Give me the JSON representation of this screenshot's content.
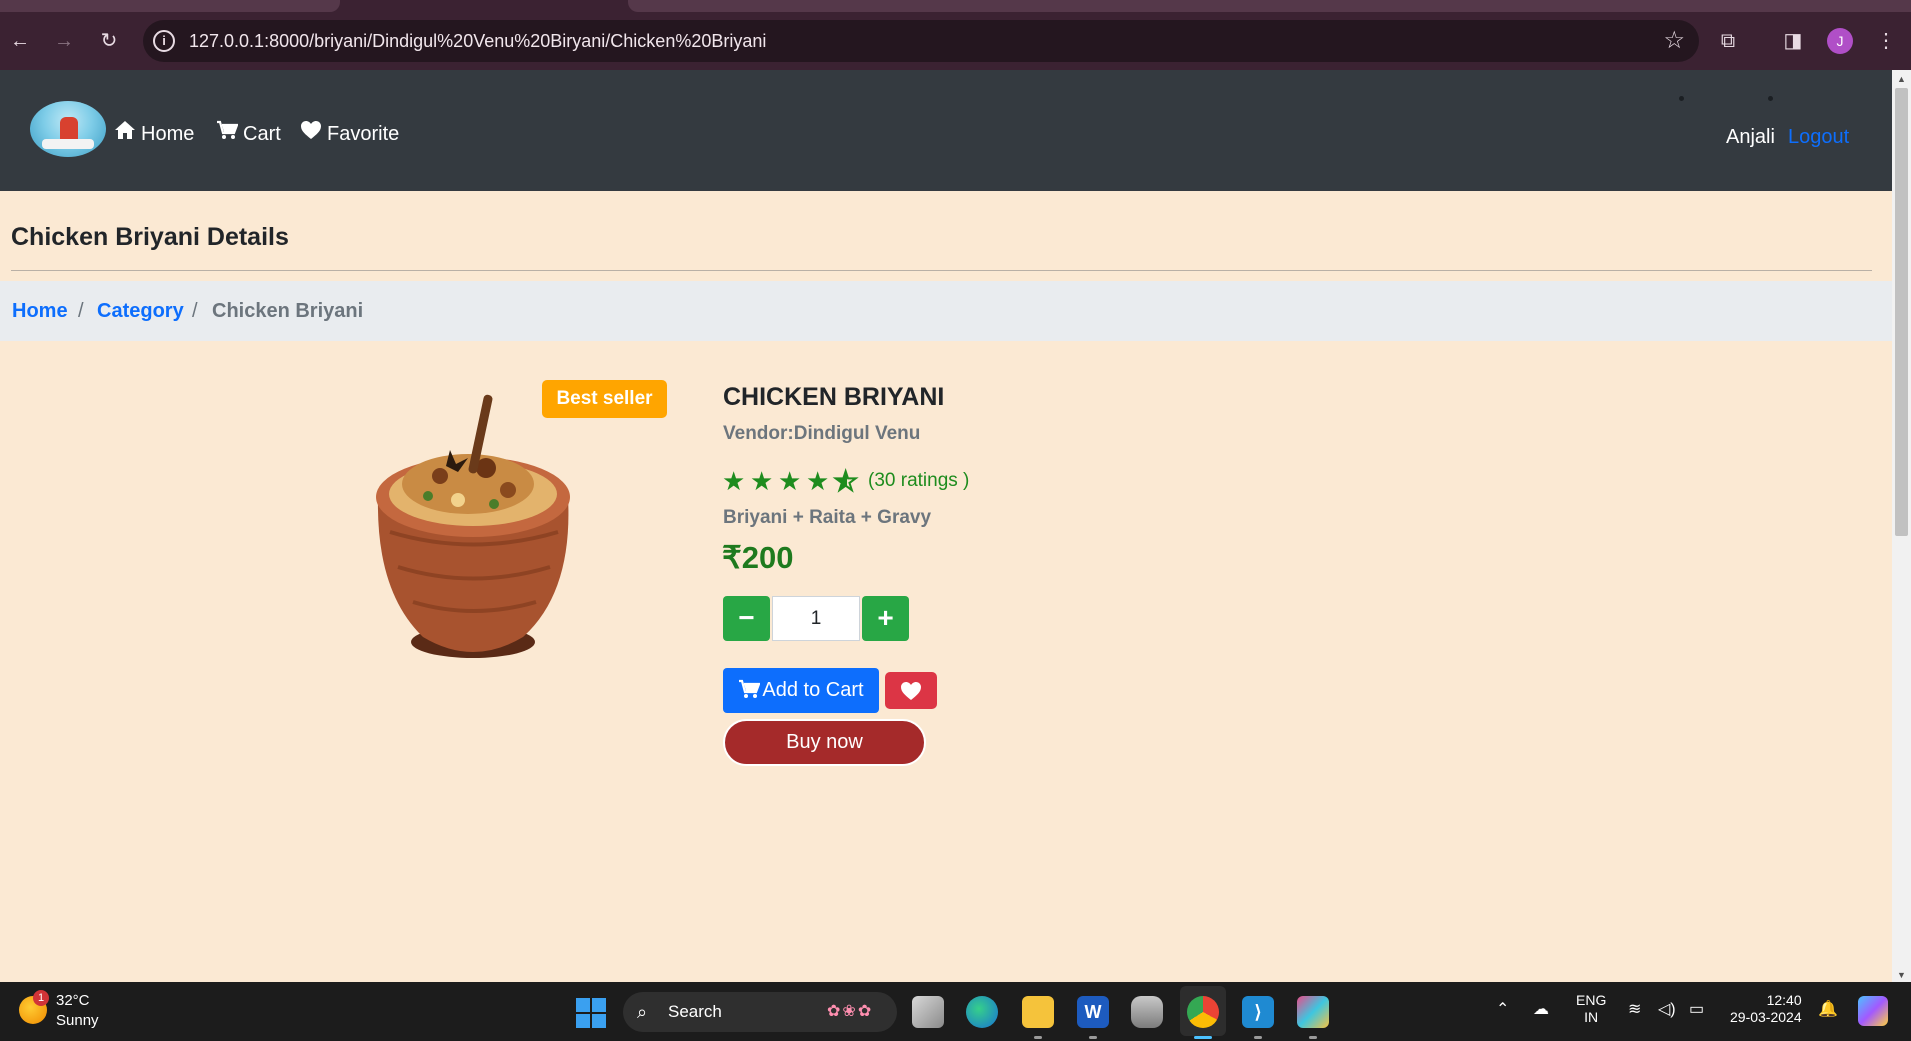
{
  "browser": {
    "url": "127.0.0.1:8000/briyani/Dindigul%20Venu%20Biryani/Chicken%20Briyani",
    "profile_initial": "J"
  },
  "navbar": {
    "links": [
      {
        "label": "Home",
        "icon": "home-icon"
      },
      {
        "label": "Cart",
        "icon": "cart-icon"
      },
      {
        "label": "Favorite",
        "icon": "heart-icon"
      }
    ],
    "user": "Anjali",
    "logout": "Logout"
  },
  "page": {
    "title": "Chicken Briyani Details"
  },
  "breadcrumb": {
    "home": "Home",
    "category": "Category",
    "current": "Chicken Briyani",
    "separator": "/"
  },
  "product": {
    "badge": "Best seller",
    "name": "CHICKEN BRIYANI",
    "vendor": "Vendor:Dindigul Venu",
    "rating": 4.5,
    "rating_max": 5,
    "ratings_text": "(30 ratings )",
    "description": "Briyani + Raita + Gravy",
    "price": "₹200",
    "quantity": "1",
    "minus_label": "−",
    "plus_label": "+",
    "add_to_cart": "Add to Cart",
    "buy_now": "Buy now"
  },
  "colors": {
    "navbar_bg": "#343a40",
    "page_bg": "#fbe9d3",
    "primary": "#0d6efd",
    "success": "#28a745",
    "danger": "#dc3545",
    "badge": "#ffa500",
    "buy_now": "#a52a2a"
  },
  "taskbar": {
    "weather_temp": "32°C",
    "weather_cond": "Sunny",
    "weather_badge": "1",
    "search": "Search",
    "lang_top": "ENG",
    "lang_bottom": "IN",
    "time": "12:40",
    "date": "29-03-2024"
  }
}
